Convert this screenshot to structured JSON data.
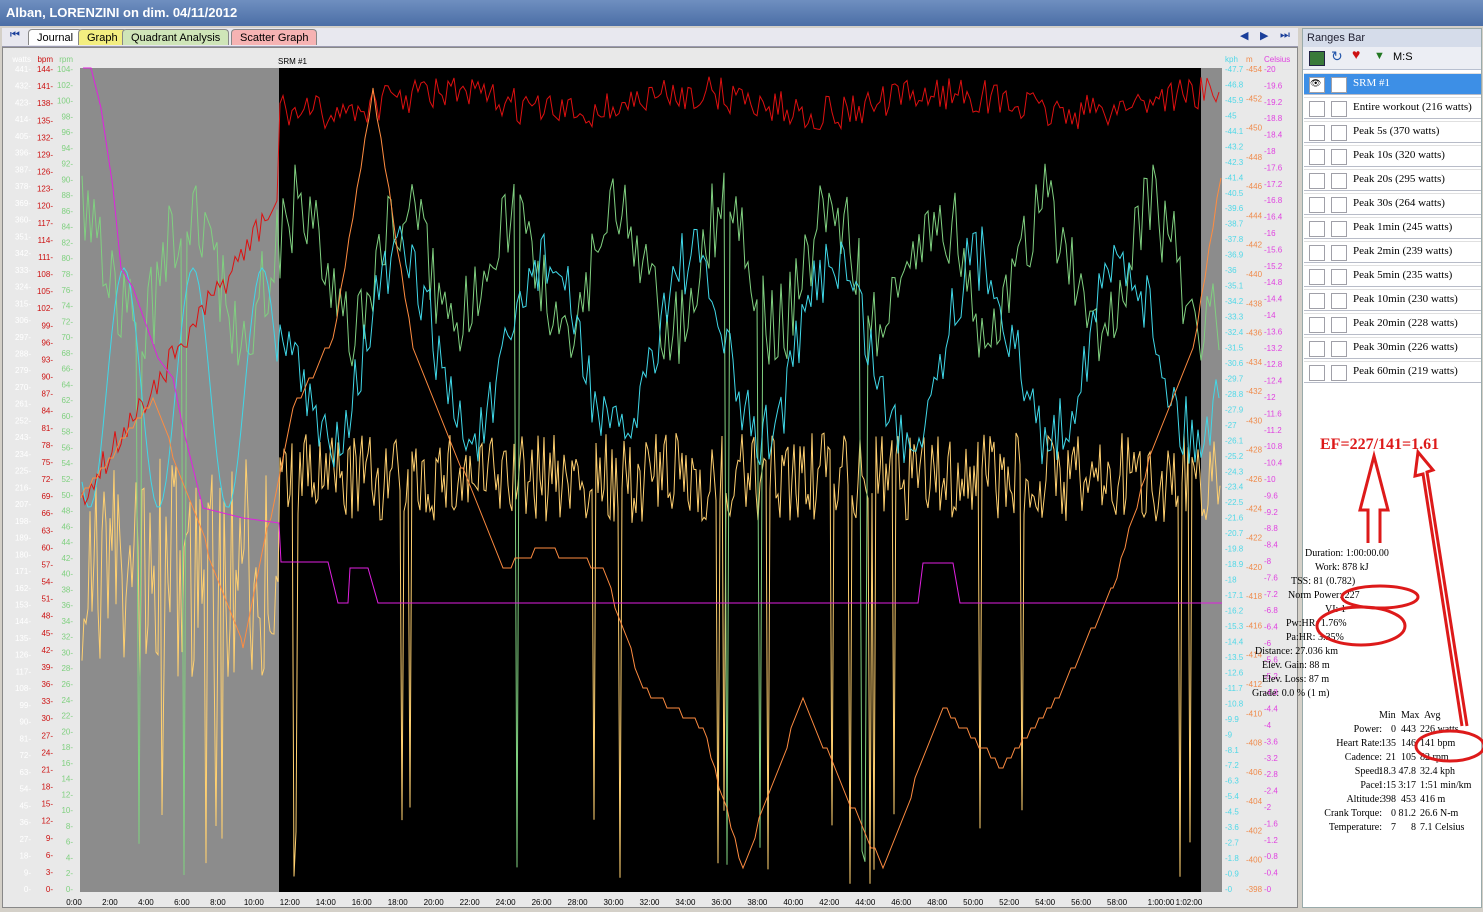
{
  "window": {
    "title": "Alban, LORENZINI on dim. 04/11/2012"
  },
  "tabs": [
    {
      "label": "Journal",
      "color": "#ffffff"
    },
    {
      "label": "Graph",
      "color": "#f3ee80"
    },
    {
      "label": "Quadrant Analysis",
      "color": "#cfe5b8"
    },
    {
      "label": "Scatter Graph",
      "color": "#f6b3b3"
    }
  ],
  "nav": {
    "first": "⏮",
    "prev": "◀",
    "next": "▶",
    "last": "⏭"
  },
  "graph": {
    "series_label": "SRM #1",
    "left_axes": [
      {
        "unit": "watts",
        "color": "#ffffff",
        "ticks": [
          "441-",
          "432-",
          "423-",
          "414-",
          "405-",
          "396-",
          "387-",
          "378-",
          "369-",
          "360-",
          "351-",
          "342-",
          "333-",
          "324-",
          "315-",
          "306-",
          "297-",
          "288-",
          "279-",
          "270-",
          "261-",
          "252-",
          "243-",
          "234-",
          "225-",
          "216-",
          "207-",
          "198-",
          "189-",
          "180-",
          "171-",
          "162-",
          "153-",
          "144-",
          "135-",
          "126-",
          "117-",
          "108-",
          "99-",
          "90-",
          "81-",
          "72-",
          "63-",
          "54-",
          "45-",
          "36-",
          "27-",
          "18-",
          "9-",
          "0-"
        ]
      },
      {
        "unit": "bpm",
        "color": "#cc1111",
        "ticks": [
          "144-",
          "141-",
          "138-",
          "135-",
          "132-",
          "129-",
          "126-",
          "123-",
          "120-",
          "117-",
          "114-",
          "111-",
          "108-",
          "105-",
          "102-",
          "99-",
          "96-",
          "93-",
          "90-",
          "87-",
          "84-",
          "81-",
          "78-",
          "75-",
          "72-",
          "69-",
          "66-",
          "63-",
          "60-",
          "57-",
          "54-",
          "51-",
          "48-",
          "45-",
          "42-",
          "39-",
          "36-",
          "33-",
          "30-",
          "27-",
          "24-",
          "21-",
          "18-",
          "15-",
          "12-",
          "9-",
          "6-",
          "3-",
          "0-"
        ]
      },
      {
        "unit": "rpm",
        "color": "#7fd07f",
        "ticks": [
          "104-",
          "102-",
          "100-",
          "98-",
          "96-",
          "94-",
          "92-",
          "90-",
          "88-",
          "86-",
          "84-",
          "82-",
          "80-",
          "78-",
          "76-",
          "74-",
          "72-",
          "70-",
          "68-",
          "66-",
          "64-",
          "62-",
          "60-",
          "58-",
          "56-",
          "54-",
          "52-",
          "50-",
          "48-",
          "46-",
          "44-",
          "42-",
          "40-",
          "38-",
          "36-",
          "34-",
          "32-",
          "30-",
          "28-",
          "26-",
          "24-",
          "22-",
          "20-",
          "18-",
          "16-",
          "14-",
          "12-",
          "10-",
          "8-",
          "6-",
          "4-",
          "2-",
          "0-"
        ]
      }
    ],
    "right_axes": [
      {
        "unit": "kph",
        "color": "#4fd8e8",
        "ticks": [
          "-47.7",
          "-46.8",
          "-45.9",
          "-45",
          "-44.1",
          "-43.2",
          "-42.3",
          "-41.4",
          "-40.5",
          "-39.6",
          "-38.7",
          "-37.8",
          "-36.9",
          "-36",
          "-35.1",
          "-34.2",
          "-33.3",
          "-32.4",
          "-31.5",
          "-30.6",
          "-29.7",
          "-28.8",
          "-27.9",
          "-27",
          "-26.1",
          "-25.2",
          "-24.3",
          "-23.4",
          "-22.5",
          "-21.6",
          "-20.7",
          "-19.8",
          "-18.9",
          "-18",
          "-17.1",
          "-16.2",
          "-15.3",
          "-14.4",
          "-13.5",
          "-12.6",
          "-11.7",
          "-10.8",
          "-9.9",
          "-9",
          "-8.1",
          "-7.2",
          "-6.3",
          "-5.4",
          "-4.5",
          "-3.6",
          "-2.7",
          "-1.8",
          "-0.9",
          "-0"
        ]
      },
      {
        "unit": "m",
        "color": "#f08a4a",
        "ticks": [
          "-454",
          "-452",
          "-450",
          "-448",
          "-446",
          "-444",
          "-442",
          "-440",
          "-438",
          "-436",
          "-434",
          "-432",
          "-430",
          "-428",
          "-426",
          "-424",
          "-422",
          "-420",
          "-418",
          "-416",
          "-414",
          "-412",
          "-410",
          "-408",
          "-406",
          "-404",
          "-402",
          "-400",
          "-398"
        ]
      },
      {
        "unit": "Celsius",
        "color": "#e040e0",
        "ticks": [
          "-20",
          "-19.6",
          "-19.2",
          "-18.8",
          "-18.4",
          "-18",
          "-17.6",
          "-17.2",
          "-16.8",
          "-16.4",
          "-16",
          "-15.6",
          "-15.2",
          "-14.8",
          "-14.4",
          "-14",
          "-13.6",
          "-13.2",
          "-12.8",
          "-12.4",
          "-12",
          "-11.6",
          "-11.2",
          "-10.8",
          "-10.4",
          "-10",
          "-9.6",
          "-9.2",
          "-8.8",
          "-8.4",
          "-8",
          "-7.6",
          "-7.2",
          "-6.8",
          "-6.4",
          "-6",
          "-5.6",
          "-5.2",
          "-4.8",
          "-4.4",
          "-4",
          "-3.6",
          "-3.2",
          "-2.8",
          "-2.4",
          "-2",
          "-1.6",
          "-1.2",
          "-0.8",
          "-0.4",
          "-0"
        ]
      }
    ],
    "x_ticks": [
      "0:00",
      "2:00",
      "4:00",
      "6:00",
      "8:00",
      "10:00",
      "12:00",
      "14:00",
      "16:00",
      "18:00",
      "20:00",
      "22:00",
      "24:00",
      "26:00",
      "28:00",
      "30:00",
      "32:00",
      "34:00",
      "36:00",
      "38:00",
      "40:00",
      "42:00",
      "44:00",
      "46:00",
      "48:00",
      "50:00",
      "52:00",
      "54:00",
      "56:00",
      "58:00",
      "1:00:00",
      "1:02:00"
    ],
    "colors": {
      "power": "#ffd070",
      "heart_rate": "#dd1010",
      "cadence": "#80d080",
      "speed": "#40d8e8",
      "altitude": "#ff8c40",
      "temperature": "#e020e0",
      "plot_bg": "#000000",
      "excluded": "#8c8c8c"
    }
  },
  "ranges_bar": {
    "title": "Ranges Bar",
    "toolbar_label": "M:S",
    "items": [
      "SRM #1",
      "Entire workout (216 watts)",
      "Peak 5s (370 watts)",
      "Peak 10s (320 watts)",
      "Peak 20s (295 watts)",
      "Peak 30s (264 watts)",
      "Peak 1min (245 watts)",
      "Peak 2min (239 watts)",
      "Peak 5min (235 watts)",
      "Peak 10min (230 watts)",
      "Peak 20min (228 watts)",
      "Peak 30min (226 watts)",
      "Peak 60min (219 watts)"
    ]
  },
  "stats": {
    "summary": [
      "Duration: 1:00:00.00",
      "Work: 878 kJ",
      "TSS: 81 (0.782)",
      "Norm Power: 227",
      "VI: 1",
      "Pw:HR: 1.76%",
      "Pa:HR: 3.35%",
      "Distance: 27.036 km",
      "Elev. Gain: 88 m",
      "Elev. Loss: 87 m",
      "Grade: 0.0 % (1 m)"
    ],
    "table_header": [
      "Min",
      "Max",
      "Avg"
    ],
    "rows": [
      {
        "label": "Power:",
        "min": "0",
        "max": "443",
        "avg": "226 watts"
      },
      {
        "label": "Heart Rate:",
        "min": "135",
        "max": "146",
        "avg": "141 bpm"
      },
      {
        "label": "Cadence:",
        "min": "21",
        "max": "105",
        "avg": "82 rpm"
      },
      {
        "label": "Speed:",
        "min": "18.3",
        "max": "47.8",
        "avg": "32.4 kph"
      },
      {
        "label": "Pace:",
        "min": "1:15",
        "max": "3:17",
        "avg": "1:51 min/km"
      },
      {
        "label": "Altitude:",
        "min": "398",
        "max": "453",
        "avg": "416 m"
      },
      {
        "label": "Crank Torque:",
        "min": "0",
        "max": "81.2",
        "avg": "26.6 N-m"
      },
      {
        "label": "Temperature:",
        "min": "7",
        "max": "8",
        "avg": "7.1 Celsius"
      }
    ]
  },
  "annotation": {
    "text": "EF=227/141=1.61",
    "color": "#dd1a1a"
  }
}
